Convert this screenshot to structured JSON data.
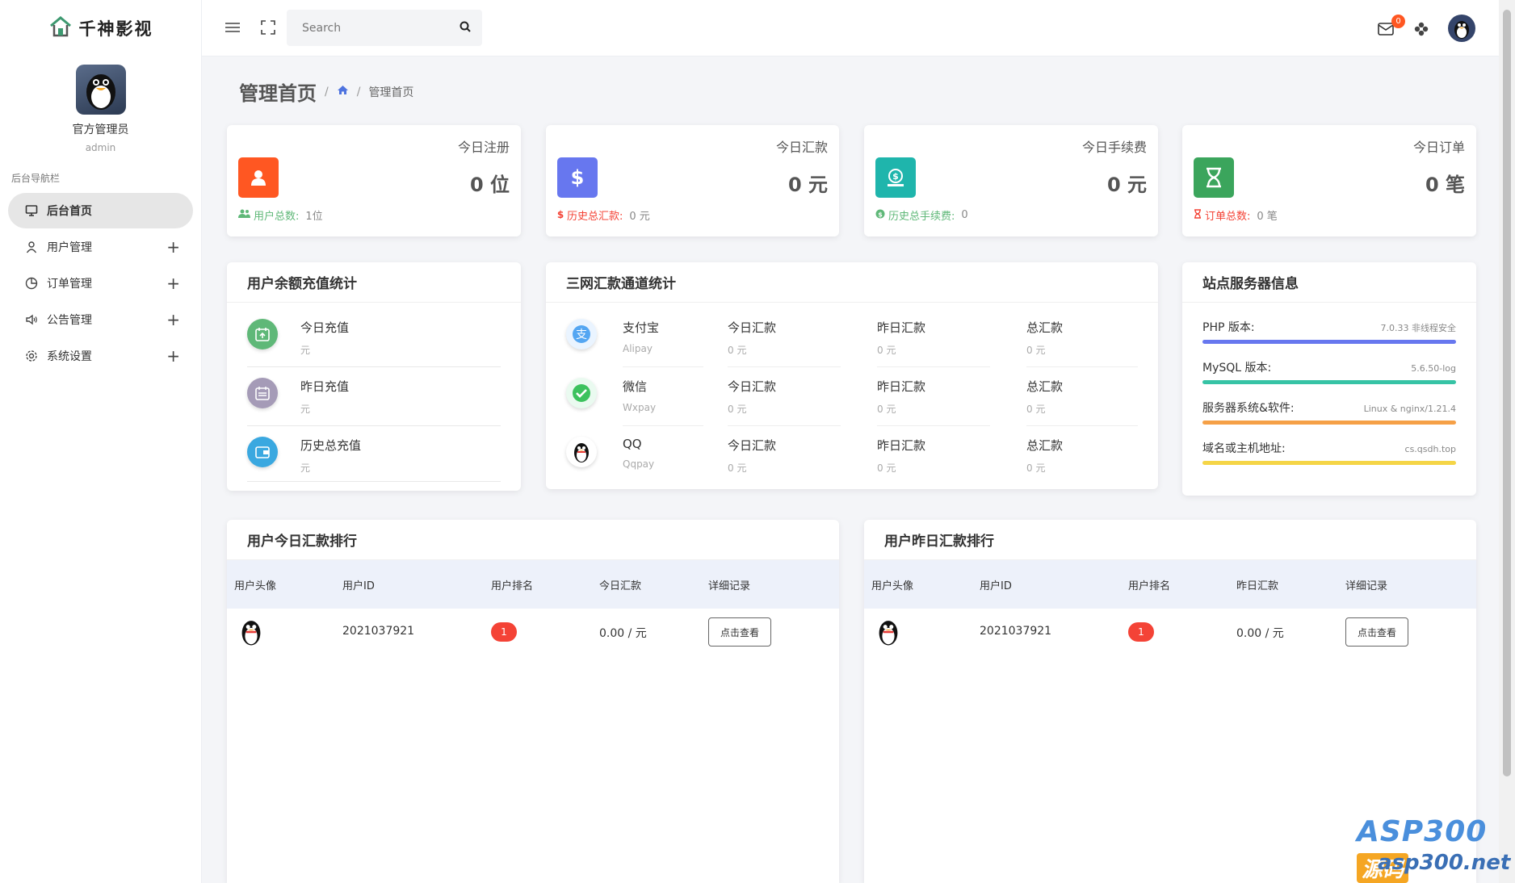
{
  "brand": {
    "title": "千神影视"
  },
  "profile": {
    "name": "官方管理员",
    "role": "admin"
  },
  "nav": {
    "title": "后台导航栏",
    "items": [
      {
        "label": "后台首页",
        "icon": "monitor-icon",
        "active": true,
        "expandable": false
      },
      {
        "label": "用户管理",
        "icon": "user-icon",
        "active": false,
        "expandable": true
      },
      {
        "label": "订单管理",
        "icon": "pie-chart-icon",
        "active": false,
        "expandable": true
      },
      {
        "label": "公告管理",
        "icon": "speaker-icon",
        "active": false,
        "expandable": true
      },
      {
        "label": "系统设置",
        "icon": "gear-icon",
        "active": false,
        "expandable": true
      }
    ],
    "plus": "+"
  },
  "topbar": {
    "search_placeholder": "Search",
    "notif_count": "0"
  },
  "page": {
    "title": "管理首页",
    "crumb_sep": "/",
    "crumb_current": "管理首页"
  },
  "stats": [
    {
      "title": "今日注册",
      "value": "0 位",
      "foot_label": "用户总数:",
      "foot_value": "1位",
      "color": "#ff5722",
      "foot_color": "#5fb878"
    },
    {
      "title": "今日汇款",
      "value": "0 元",
      "foot_label": "历史总汇款:",
      "foot_value": "0 元",
      "color": "#6777ef",
      "foot_color": "#f44336"
    },
    {
      "title": "今日手续费",
      "value": "0 元",
      "foot_label": "历史总手续费:",
      "foot_value": "0",
      "color": "#1fb5ac",
      "foot_color": "#5fb878"
    },
    {
      "title": "今日订单",
      "value": "0 笔",
      "foot_label": "订单总数:",
      "foot_value": "0 笔",
      "color": "#3ba55c",
      "foot_color": "#f44336"
    }
  ],
  "recharge": {
    "title": "用户余额充值统计",
    "items": [
      {
        "label": "今日充值",
        "sub": "元"
      },
      {
        "label": "昨日充值",
        "sub": "元"
      },
      {
        "label": "历史总充值",
        "sub": "元"
      }
    ]
  },
  "channels": {
    "title": "三网汇款通道统计",
    "rows": [
      {
        "name": "支付宝",
        "code": "Alipay",
        "today_label": "今日汇款",
        "today_val": "0 元",
        "yest_label": "昨日汇款",
        "yest_val": "0 元",
        "total_label": "总汇款",
        "total_val": "0 元"
      },
      {
        "name": "微信",
        "code": "Wxpay",
        "today_label": "今日汇款",
        "today_val": "0 元",
        "yest_label": "昨日汇款",
        "yest_val": "0 元",
        "total_label": "总汇款",
        "total_val": "0 元"
      },
      {
        "name": "QQ",
        "code": "Qqpay",
        "today_label": "今日汇款",
        "today_val": "0 元",
        "yest_label": "昨日汇款",
        "yest_val": "0 元",
        "total_label": "总汇款",
        "total_val": "0 元"
      }
    ]
  },
  "server": {
    "title": "站点服务器信息",
    "rows": [
      {
        "label": "PHP 版本:",
        "value": "7.0.33 非线程安全",
        "color": "#6777ef"
      },
      {
        "label": "MySQL 版本:",
        "value": "5.6.50-log",
        "color": "#36c3a5"
      },
      {
        "label": "服务器系统&软件:",
        "value": "Linux & nginx/1.21.4",
        "color": "#f5a047"
      },
      {
        "label": "域名或主机地址:",
        "value": "cs.qsdh.top",
        "color": "#f5d547"
      }
    ]
  },
  "today_rank": {
    "title": "用户今日汇款排行",
    "headers": [
      "用户头像",
      "用户ID",
      "用户排名",
      "今日汇款",
      "详细记录"
    ],
    "rows": [
      {
        "user_id": "2021037921",
        "rank": "1",
        "amount": "0.00 / 元",
        "action": "点击查看"
      }
    ]
  },
  "yest_rank": {
    "title": "用户昨日汇款排行",
    "headers": [
      "用户头像",
      "用户ID",
      "用户排名",
      "昨日汇款",
      "详细记录"
    ],
    "rows": [
      {
        "user_id": "2021037921",
        "rank": "1",
        "amount": "0.00 / 元",
        "action": "点击查看"
      }
    ]
  },
  "watermark": {
    "line1": "ASP300",
    "badge": "源码",
    "line2": "asp300.net"
  }
}
